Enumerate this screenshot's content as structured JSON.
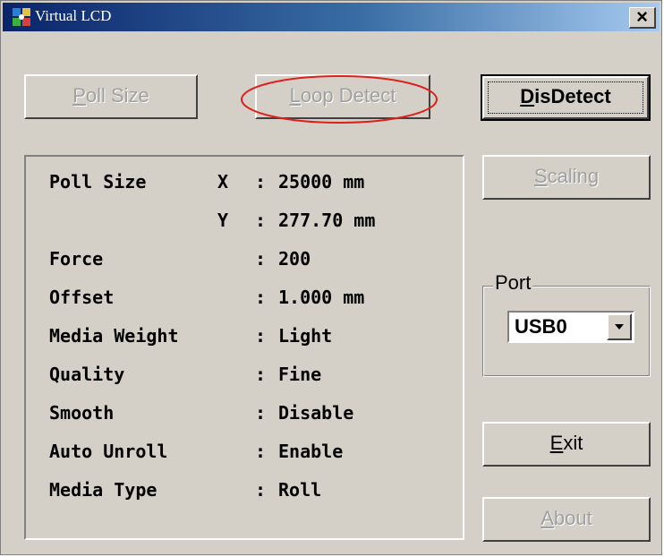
{
  "window": {
    "title": "Virtual LCD",
    "close_glyph": "×",
    "icon": "app-icon"
  },
  "buttons": {
    "poll_size": {
      "prefix": "",
      "mnemonic": "P",
      "rest": "oll Size",
      "enabled": false
    },
    "loop_detect": {
      "prefix": "",
      "mnemonic": "L",
      "rest": "oop Detect",
      "enabled": false
    },
    "disdetect": {
      "prefix": "",
      "mnemonic": "D",
      "rest": "isDetect",
      "enabled": true,
      "default": true
    },
    "scaling": {
      "prefix": "",
      "mnemonic": "S",
      "rest": "caling",
      "enabled": false
    },
    "exit": {
      "prefix": "",
      "mnemonic": "E",
      "rest": "xit",
      "enabled": true
    },
    "about": {
      "prefix": "",
      "mnemonic": "A",
      "rest": "bout",
      "enabled": false
    }
  },
  "info": {
    "rows": [
      {
        "label": "Poll Size",
        "axis": "X",
        "colon": ":",
        "value": "25000 mm"
      },
      {
        "label": "",
        "axis": "Y",
        "colon": ":",
        "value": "277.70 mm"
      },
      {
        "label": "Force",
        "axis": "",
        "colon": ":",
        "value": "200"
      },
      {
        "label": "Offset",
        "axis": "",
        "colon": ":",
        "value": "1.000 mm"
      },
      {
        "label": "Media Weight",
        "axis": "",
        "colon": ":",
        "value": "Light"
      },
      {
        "label": "Quality",
        "axis": "",
        "colon": ":",
        "value": "Fine"
      },
      {
        "label": "Smooth",
        "axis": "",
        "colon": ":",
        "value": "Disable"
      },
      {
        "label": "Auto Unroll",
        "axis": "",
        "colon": ":",
        "value": "Enable"
      },
      {
        "label": "Media Type",
        "axis": "",
        "colon": ":",
        "value": "Roll"
      }
    ]
  },
  "port": {
    "legend": "Port",
    "selected": "USB0"
  },
  "colors": {
    "face": "#d4d0c8",
    "title_start": "#0a246a",
    "title_end": "#a6caf0",
    "disabled_text": "#a0a0a0",
    "annotation": "#e0201c"
  }
}
